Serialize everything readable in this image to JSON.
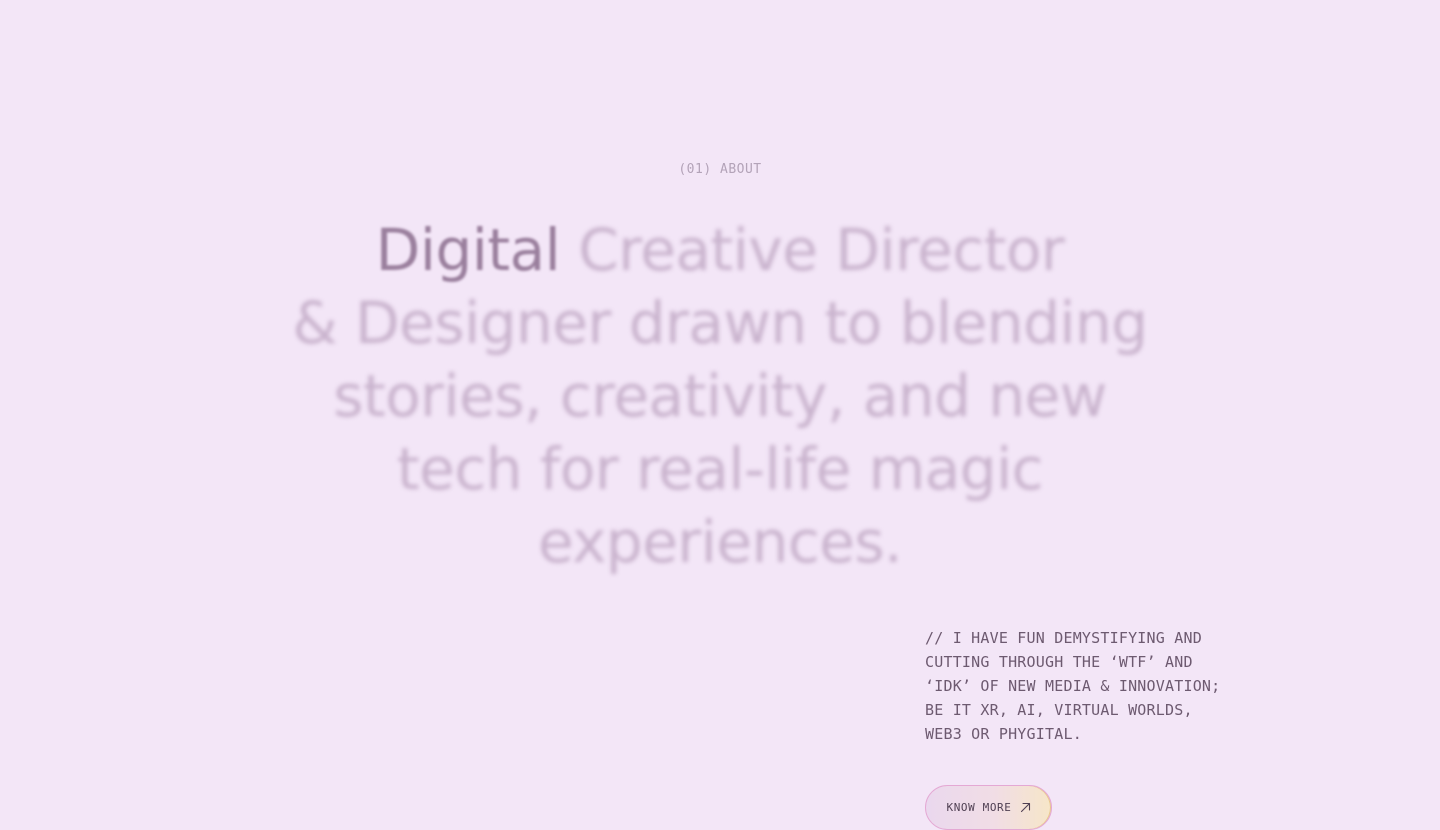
{
  "about": {
    "section_label": "(01) ABOUT",
    "headline": {
      "highlight": "Digital",
      "line1_rest": " Creative Director",
      "line2": "& Designer drawn to blending",
      "line3": "stories, creativity, and new",
      "line4": "tech for real-life magic",
      "line5": "experiences."
    },
    "blurb": {
      "line1": "// I HAVE FUN DEMYSTIFYING AND",
      "line2": "CUTTING THROUGH THE ‘WTF’ AND",
      "line3": "‘IDK’ OF NEW MEDIA & INNOVATION;",
      "line4": "BE IT XR, AI, VIRTUAL WORLDS,",
      "line5": "WEB3 OR PHYGITAL."
    },
    "cta": {
      "label": "KNOW MORE",
      "icon": "arrow-up-right-icon"
    }
  },
  "colors": {
    "background": "#f3e6f7",
    "headline_dim": "#c9b3cd",
    "headline_strong": "#9a7f9d",
    "body_text": "#6d5a70"
  }
}
